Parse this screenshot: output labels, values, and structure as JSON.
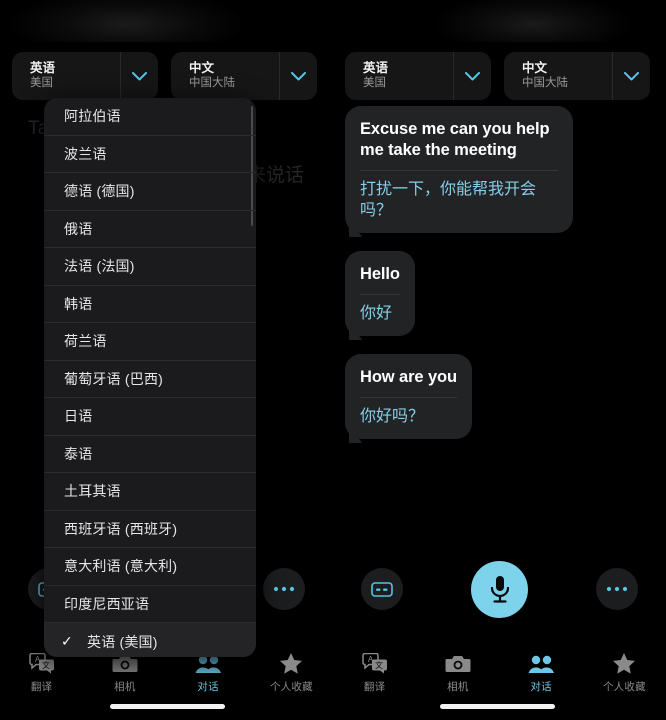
{
  "app": {
    "accent_cyan": "#7dd3ec",
    "bubble_bg": "#222325",
    "translation_text_color": "#86cfe8"
  },
  "language_selector": {
    "source": {
      "name": "英语",
      "region": "美国",
      "chevron_icon": "chevron-down-icon"
    },
    "target": {
      "name": "中文",
      "region": "中国大陆",
      "chevron_icon": "chevron-down-icon"
    }
  },
  "background_hints": {
    "left_partial": "Ta",
    "right_partial": "来说话"
  },
  "conversation": {
    "messages": [
      {
        "source": "Excuse me can you help me take the meeting",
        "translation": "打扰一下，你能帮我开会吗？"
      },
      {
        "source": "Hello",
        "translation": "你好"
      },
      {
        "source": "How are you",
        "translation": "你好吗？"
      }
    ]
  },
  "actions": {
    "captions": {
      "label": "",
      "icon": "closed-captions-icon"
    },
    "microphone": {
      "label": "",
      "icon": "microphone-icon"
    },
    "more": {
      "label": "",
      "icon": "more-dots-icon"
    }
  },
  "tabbar": {
    "tabs": [
      {
        "label": "翻译",
        "icon": "translate-icon",
        "active": false
      },
      {
        "label": "相机",
        "icon": "camera-icon",
        "active": false
      },
      {
        "label": "对话",
        "icon": "conversation-people-icon",
        "active": true
      },
      {
        "label": "个人收藏",
        "icon": "star-icon",
        "active": false
      }
    ]
  },
  "dropdown": {
    "title": "",
    "items": [
      {
        "label": "阿拉伯语",
        "selected": false
      },
      {
        "label": "波兰语",
        "selected": false
      },
      {
        "label": "德语 (德国)",
        "selected": false
      },
      {
        "label": "俄语",
        "selected": false
      },
      {
        "label": "法语 (法国)",
        "selected": false
      },
      {
        "label": "韩语",
        "selected": false
      },
      {
        "label": "荷兰语",
        "selected": false
      },
      {
        "label": "葡萄牙语 (巴西)",
        "selected": false
      },
      {
        "label": "日语",
        "selected": false
      },
      {
        "label": "泰语",
        "selected": false
      },
      {
        "label": "土耳其语",
        "selected": false
      },
      {
        "label": "西班牙语 (西班牙)",
        "selected": false
      },
      {
        "label": "意大利语 (意大利)",
        "selected": false
      },
      {
        "label": "印度尼西亚语",
        "selected": false
      },
      {
        "label": "英语 (美国)",
        "selected": true
      }
    ],
    "checkmark": "✓"
  }
}
